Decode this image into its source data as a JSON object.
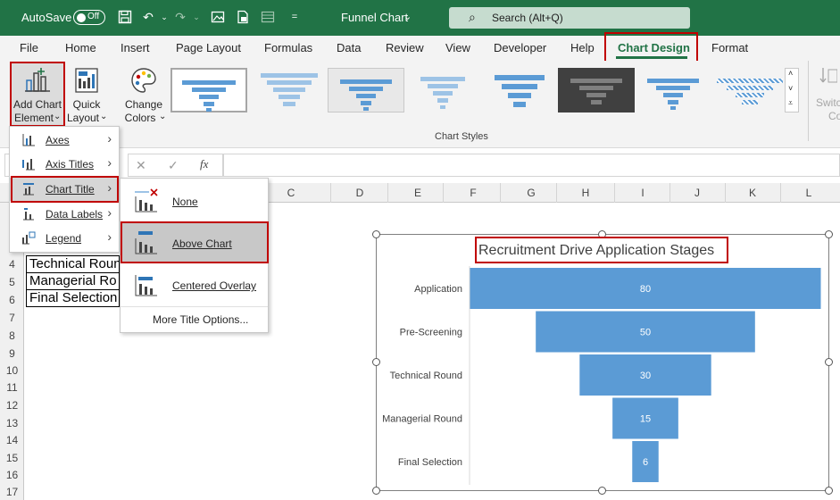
{
  "titlebar": {
    "autosave": "AutoSave",
    "toggle": "Off",
    "filename": "Funnel Chart",
    "search": "Search (Alt+Q)"
  },
  "tabs": [
    "File",
    "Home",
    "Insert",
    "Page Layout",
    "Formulas",
    "Data",
    "Review",
    "View",
    "Developer",
    "Help",
    "Chart Design",
    "Format"
  ],
  "ribbon": {
    "add_chart_element": [
      "Add Chart",
      "Element"
    ],
    "quick_layout": [
      "Quick",
      "Layout"
    ],
    "change_colors": [
      "Change",
      "Colors"
    ],
    "chart_styles_label": "Chart Styles",
    "switch_label": [
      "Switc",
      "Co"
    ]
  },
  "columns": [
    "C",
    "D",
    "E",
    "F",
    "G",
    "H",
    "I",
    "J",
    "K",
    "L"
  ],
  "rows": [
    "4",
    "5",
    "6",
    "7",
    "8",
    "9",
    "10",
    "11",
    "12",
    "13",
    "14",
    "15",
    "16",
    "17"
  ],
  "cells": [
    "Technical Roun",
    "Managerial Ro",
    "Final Selection"
  ],
  "menu1": {
    "items": [
      {
        "label": "Axes"
      },
      {
        "label": "Axis Titles"
      },
      {
        "label": "Chart Title"
      },
      {
        "label": "Data Labels"
      },
      {
        "label": "Legend"
      }
    ]
  },
  "menu2": {
    "items": [
      {
        "label": "None"
      },
      {
        "label": "Above Chart"
      },
      {
        "label": "Centered Overlay"
      }
    ],
    "more": "More Title Options..."
  },
  "chart_data": {
    "type": "bar",
    "orientation": "funnel",
    "title": "Recruitment Drive Application Stages",
    "categories": [
      "Application",
      "Pre-Screening",
      "Technical Round",
      "Managerial Round",
      "Final Selection"
    ],
    "values": [
      80,
      50,
      30,
      15,
      6
    ],
    "color": "#5b9bd5"
  }
}
